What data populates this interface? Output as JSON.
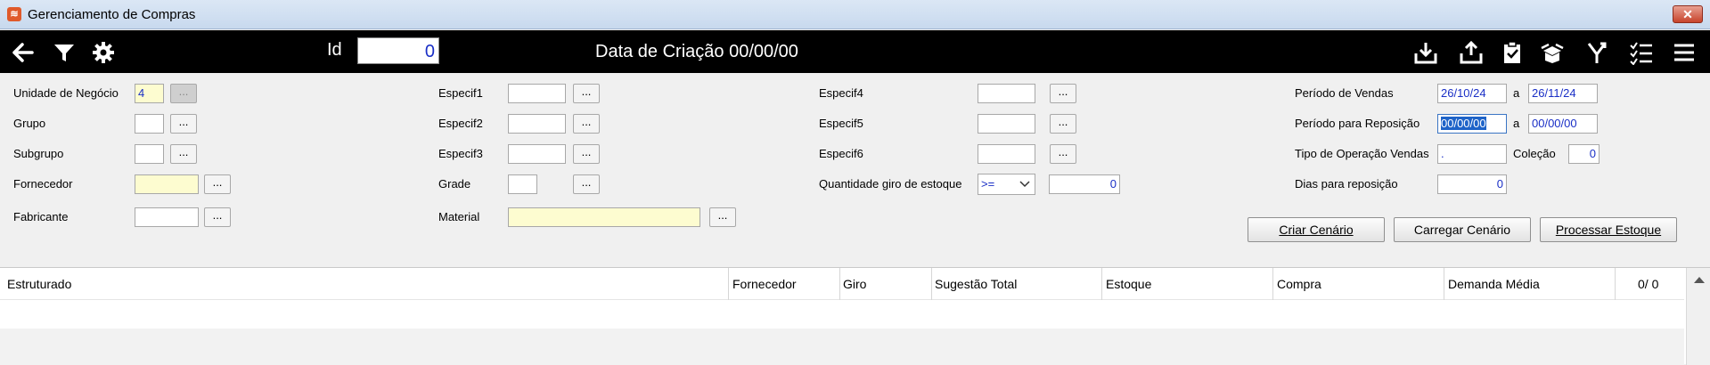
{
  "window": {
    "title": "Gerenciamento de Compras",
    "close_glyph": "✕"
  },
  "toolbar": {
    "id_label": "Id",
    "id_value": "0",
    "data_criacao": "Data de Criação 00/00/00",
    "icons": [
      "back-arrow-icon",
      "filter-icon",
      "gear-icon",
      "download-icon",
      "upload-icon",
      "clipboard-check-icon",
      "open-box-icon",
      "split-arrow-icon",
      "checklist-icon",
      "menu-icon"
    ]
  },
  "form": {
    "unidade": {
      "label": "Unidade de Negócio",
      "value": "4"
    },
    "grupo": {
      "label": "Grupo",
      "value": ""
    },
    "subgrupo": {
      "label": "Subgrupo",
      "value": ""
    },
    "fornecedor": {
      "label": "Fornecedor",
      "value": ""
    },
    "fabricante": {
      "label": "Fabricante",
      "value": ""
    },
    "especif1": {
      "label": "Especif1",
      "value": ""
    },
    "especif2": {
      "label": "Especif2",
      "value": ""
    },
    "especif3": {
      "label": "Especif3",
      "value": ""
    },
    "grade": {
      "label": "Grade",
      "value": ""
    },
    "material": {
      "label": "Material",
      "value": ""
    },
    "especif4": {
      "label": "Especif4",
      "value": ""
    },
    "especif5": {
      "label": "Especif5",
      "value": ""
    },
    "especif6": {
      "label": "Especif6",
      "value": ""
    },
    "giro": {
      "label": "Quantidade giro de estoque",
      "operator": ">=",
      "value": "0"
    },
    "periodo_vendas": {
      "label": "Período de Vendas",
      "from": "26/10/24",
      "sep": "a",
      "to": "26/11/24"
    },
    "periodo_reposicao": {
      "label": "Período para Reposição",
      "from": "00/00/00",
      "sep": "a",
      "to": "00/00/00"
    },
    "tipo_operacao": {
      "label": "Tipo de Operação Vendas",
      "value": "."
    },
    "colecao": {
      "label": "Coleção",
      "value": "0"
    },
    "dias_reposicao": {
      "label": "Dias para reposição",
      "value": "0"
    },
    "dots": "..."
  },
  "buttons": {
    "criar_cenario": "Criar Cenário",
    "carregar_cenario": "Carregar Cenário",
    "processar_estoque": "Processar Estoque"
  },
  "grid": {
    "columns": [
      "Estruturado",
      "Fornecedor",
      "Giro",
      "Sugestão Total",
      "Estoque",
      "Compra",
      "Demanda Média"
    ],
    "counter": "0/  0"
  }
}
